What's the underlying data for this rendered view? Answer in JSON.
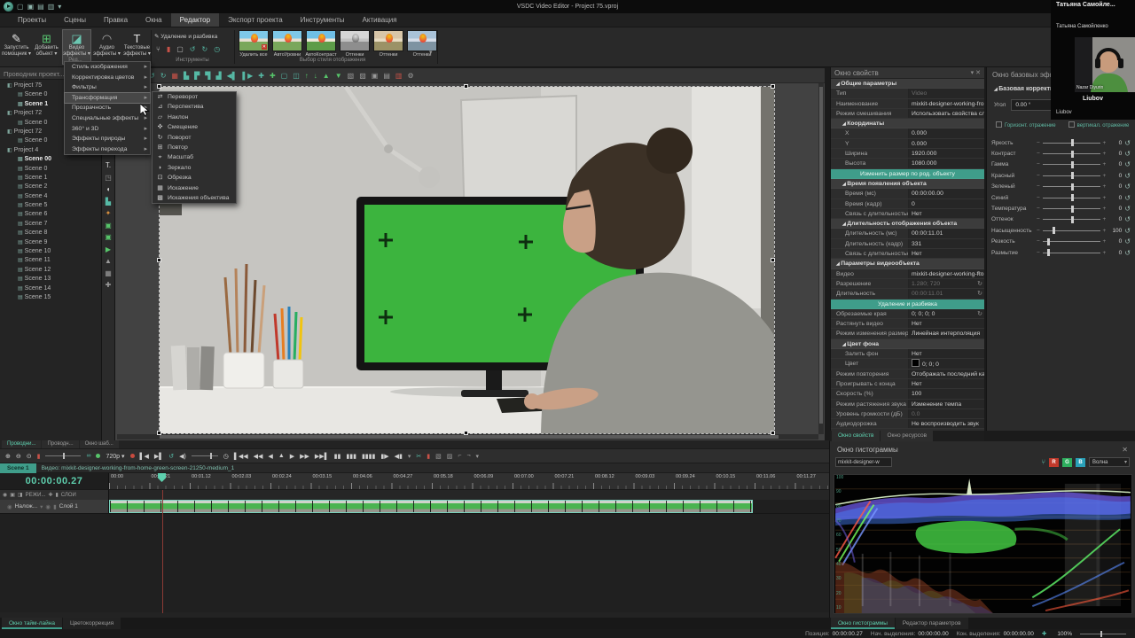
{
  "colors": {
    "accent": "#3f9d8a",
    "accent_text": "#5ecfae",
    "record": "#c84b3f",
    "greenscr": "#3cb43e"
  },
  "titlebar": {
    "title": "VSDC Video Editor - Project 75.vproj"
  },
  "menubar": {
    "items": [
      {
        "label": "Проекты"
      },
      {
        "label": "Сцены"
      },
      {
        "label": "Правка"
      },
      {
        "label": "Окна"
      },
      {
        "label": "Редактор",
        "cls": "active"
      },
      {
        "label": "Экспорт проекта"
      },
      {
        "label": "Инструменты"
      },
      {
        "label": "Активация"
      }
    ]
  },
  "ribbon": {
    "group1_label": "Ред...",
    "big_buttons": [
      {
        "icon": "✎",
        "iconc": "ic-white",
        "line1": "Запустить",
        "line2": "помощник ▾"
      },
      {
        "icon": "⊞",
        "iconc": "ic-green",
        "line1": "Добавить",
        "line2": "объект ▾"
      },
      {
        "icon": "◪",
        "iconc": "ic-teal",
        "line1": "Видео",
        "line2": "эффекты ▾",
        "cls": "pressed"
      },
      {
        "icon": "◠",
        "iconc": "ic-gray",
        "line1": "Аудио",
        "line2": "эффекты ▾"
      },
      {
        "icon": "T",
        "iconc": "ic-white",
        "line1": "Текстовые",
        "line2": "эффекты ▾"
      }
    ],
    "tools": {
      "title": "✎ Удаление и разбивка",
      "label": "Инструменты",
      "icons": [
        {
          "g": "⑂"
        },
        {
          "g": "▮",
          "c": "red"
        },
        {
          "g": "▢"
        },
        {
          "g": "↺",
          "c": "teal"
        },
        {
          "g": "↻",
          "c": "teal"
        },
        {
          "g": "◷",
          "c": "teal"
        }
      ]
    },
    "styles": {
      "label": "Выбор стиля отображения",
      "more": "▾",
      "thumbs": [
        {
          "label": "Удалить все",
          "cls": "t-color t-badge"
        },
        {
          "label": "АвтоУровни",
          "cls": "t-color"
        },
        {
          "label": "АвтоКонтраст",
          "cls": "t-color2"
        },
        {
          "label": "Оттенки",
          "cls": "t-gray"
        },
        {
          "label": "Оттенки",
          "cls": "t-warm"
        },
        {
          "label": "Оттенки",
          "cls": "t-cool"
        }
      ]
    }
  },
  "toolbar2": {
    "icons": [
      {
        "g": "↺"
      },
      {
        "g": "↻"
      },
      {
        "g": "▦",
        "c": "red"
      },
      {
        "g": "▙"
      },
      {
        "g": "▛"
      },
      {
        "g": "▜"
      },
      {
        "g": "▟"
      },
      {
        "g": "◀▌"
      },
      {
        "g": "▌▶"
      },
      {
        "g": "✚"
      },
      {
        "g": "✚",
        "c": "green"
      },
      {
        "g": "▢"
      },
      {
        "g": "◫"
      },
      {
        "g": "↑",
        "c": "green"
      },
      {
        "g": "↓",
        "c": "green"
      },
      {
        "g": "▲",
        "c": "green"
      },
      {
        "g": "▼",
        "c": "green"
      },
      {
        "g": "▧",
        "c": "gray"
      },
      {
        "g": "▨",
        "c": "gray"
      },
      {
        "g": "▣",
        "c": "gray"
      },
      {
        "g": "▤",
        "c": "gray"
      },
      {
        "g": "▥",
        "c": "red"
      },
      {
        "g": "⚙",
        "c": "gray"
      }
    ]
  },
  "explorer": {
    "title": "Проводник проект...",
    "items": [
      {
        "icon": "◧",
        "label": "Project 75",
        "cls": "lvl0"
      },
      {
        "icon": "▤",
        "label": "Scene 0",
        "cls": "lvl1"
      },
      {
        "icon": "▤",
        "label": "Scene 1",
        "cls": "lvl1 bold"
      },
      {
        "icon": "◧",
        "label": "Project 72",
        "cls": "lvl0"
      },
      {
        "icon": "▤",
        "label": "Scene 0",
        "cls": "lvl1"
      },
      {
        "icon": "◧",
        "label": "Project 72",
        "cls": "lvl0"
      },
      {
        "icon": "▤",
        "label": "Scene 0",
        "cls": "lvl1"
      },
      {
        "icon": "◧",
        "label": "Project 4",
        "cls": "lvl0"
      },
      {
        "icon": "▤",
        "label": "Scene 00",
        "cls": "lvl1 bold"
      },
      {
        "icon": "▤",
        "label": "Scene 0",
        "cls": "lvl1"
      },
      {
        "icon": "▤",
        "label": "Scene 1",
        "cls": "lvl1"
      },
      {
        "icon": "▤",
        "label": "Scene 2",
        "cls": "lvl1"
      },
      {
        "icon": "▤",
        "label": "Scene 4",
        "cls": "lvl1"
      },
      {
        "icon": "▤",
        "label": "Scene 5",
        "cls": "lvl1"
      },
      {
        "icon": "▤",
        "label": "Scene 6",
        "cls": "lvl1"
      },
      {
        "icon": "▤",
        "label": "Scene 7",
        "cls": "lvl1"
      },
      {
        "icon": "▤",
        "label": "Scene 8",
        "cls": "lvl1"
      },
      {
        "icon": "▤",
        "label": "Scene 9",
        "cls": "lvl1"
      },
      {
        "icon": "▤",
        "label": "Scene 10",
        "cls": "lvl1"
      },
      {
        "icon": "▤",
        "label": "Scene 11",
        "cls": "lvl1"
      },
      {
        "icon": "▤",
        "label": "Scene 12",
        "cls": "lvl1"
      },
      {
        "icon": "▤",
        "label": "Scene 13",
        "cls": "lvl1"
      },
      {
        "icon": "▤",
        "label": "Scene 14",
        "cls": "lvl1"
      },
      {
        "icon": "▤",
        "label": "Scene 15",
        "cls": "lvl1"
      }
    ]
  },
  "vtoolbar": {
    "icons": [
      {
        "g": "T.",
        "c": "w"
      },
      {
        "g": "◳",
        "c": "gray"
      },
      {
        "g": "◖",
        "c": "w"
      },
      {
        "g": "▙",
        "c": "teal"
      },
      {
        "g": "✦",
        "c": "orange"
      },
      {
        "g": "▣",
        "c": "green"
      },
      {
        "g": "▣",
        "c": "green"
      },
      {
        "g": "▶",
        "c": "green"
      },
      {
        "g": "▲",
        "c": "gray"
      },
      {
        "g": "▦",
        "c": "gray"
      },
      {
        "g": "✚",
        "c": "gray"
      }
    ]
  },
  "effects_menu": {
    "items": [
      {
        "label": "Стиль изображения"
      },
      {
        "label": "Корректировка цветов"
      },
      {
        "label": "Фильтры"
      },
      {
        "label": "Трансформация",
        "cls": "hl"
      },
      {
        "label": "Прозрачность"
      },
      {
        "label": "Специальные эффекты"
      },
      {
        "label": "360° и 3D"
      },
      {
        "label": "Эффекты природы"
      },
      {
        "label": "Эффекты перехода"
      }
    ]
  },
  "transform_submenu": {
    "items": [
      {
        "icon": "⇄",
        "c": "teal",
        "label": "Переворот"
      },
      {
        "icon": "⊿",
        "c": "teal",
        "label": "Перспектива"
      },
      {
        "icon": "▱",
        "c": "teal",
        "label": "Наклон"
      },
      {
        "icon": "✜",
        "c": "red",
        "label": "Смещение"
      },
      {
        "icon": "↻",
        "c": "teal",
        "label": "Поворот"
      },
      {
        "icon": "⊞",
        "c": "green",
        "label": "Повтор"
      },
      {
        "icon": "⌖",
        "c": "teal",
        "label": "Масштаб"
      },
      {
        "icon": "◗",
        "c": "gray",
        "label": "Зеркало"
      },
      {
        "icon": "⊡",
        "c": "teal",
        "label": "Обрезка"
      },
      {
        "icon": "▦",
        "c": "red",
        "label": "Искажение"
      },
      {
        "icon": "▩",
        "c": "red",
        "label": "Искажения объектива"
      }
    ]
  },
  "properties": {
    "title": "Окно свойств",
    "pin": "▾",
    "close": "✕",
    "rows": [
      {
        "cls": "sec",
        "label": "Общие параметры",
        "value": ""
      },
      {
        "cls": "dim",
        "label": "Тип",
        "value": "Video"
      },
      {
        "label": "Наименование",
        "value": "mixkit-designer-working-from-l"
      },
      {
        "label": "Режим смешивания",
        "value": "Использовать свойства слоя"
      },
      {
        "cls": "sec sub",
        "label": "Координаты",
        "value": ""
      },
      {
        "cls": "ind",
        "label": "X",
        "value": "0.000"
      },
      {
        "cls": "ind",
        "label": "Y",
        "value": "0.000"
      },
      {
        "cls": "ind",
        "label": "Ширина",
        "value": "1920.000"
      },
      {
        "cls": "ind",
        "label": "Высота",
        "value": "1080.000"
      },
      {
        "cls": "btn",
        "label": "Изменить размер по род. объекту",
        "value": ""
      },
      {
        "cls": "sec sub",
        "label": "Время появления объекта",
        "value": ""
      },
      {
        "cls": "ind",
        "label": "Время (мс)",
        "value": "00:00:00.00"
      },
      {
        "cls": "ind",
        "label": "Время (кадр)",
        "value": "0"
      },
      {
        "cls": "ind",
        "label": "Связь с длительностью р...",
        "value": "Нет"
      },
      {
        "cls": "sec sub",
        "label": "Длительность отображения объекта",
        "value": ""
      },
      {
        "cls": "ind",
        "label": "Длительность (мс)",
        "value": "00:00:11.01"
      },
      {
        "cls": "ind",
        "label": "Длительность (кадр)",
        "value": "331"
      },
      {
        "cls": "ind",
        "label": "Связь с длительностью р...",
        "value": "Нет"
      },
      {
        "cls": "sec",
        "label": "Параметры видеообъекта",
        "value": ""
      },
      {
        "cls": "ricon",
        "label": "Видео",
        "value": "mixkit-designer-working-fro"
      },
      {
        "cls": "dim ricon",
        "label": "Разрешение",
        "value": "1.280; 720"
      },
      {
        "cls": "dim ricon",
        "label": "Длительность",
        "value": "00:00:11.01"
      },
      {
        "cls": "btn",
        "label": "Удаление и разбивка",
        "value": ""
      },
      {
        "cls": "ricon",
        "label": "Обрезаемые края",
        "value": "0; 0; 0; 0"
      },
      {
        "label": "Растянуть видео",
        "value": "Нет"
      },
      {
        "label": "Режим изменения размера",
        "value": "Линейная интерполяция"
      },
      {
        "cls": "sec sub",
        "label": "Цвет фона",
        "value": ""
      },
      {
        "cls": "ind",
        "label": "Залить фон",
        "value": "Нет"
      },
      {
        "cls": "ind swatch",
        "label": "Цвет",
        "value": "0; 0; 0"
      },
      {
        "label": "Режим повторения",
        "value": "Отображать последний кадр п"
      },
      {
        "label": "Проигрывать с конца",
        "value": "Нет"
      },
      {
        "label": "Скорость (%)",
        "value": "100"
      },
      {
        "label": "Режим растяжения звука",
        "value": "Изменение темпа"
      },
      {
        "cls": "dim",
        "label": "Уровень громкости (дБ)",
        "value": "0.0"
      },
      {
        "label": "Аудиодорожка",
        "value": "Не воспроизводить звук"
      }
    ],
    "tabs": [
      {
        "label": "Окно свойств",
        "cls": "active"
      },
      {
        "label": "Окно ресурсов"
      }
    ]
  },
  "basic_effects": {
    "title": "Окно базовых эффектов",
    "section": "Базовая корректировка",
    "angle_label": "Угол",
    "angle_value": "0.00 °",
    "flip_h": "Горизонт. отражение",
    "flip_v": "вертикал. отражение",
    "reset_icon": "↺",
    "sliders": [
      {
        "label": "Яркость",
        "value": "0",
        "style": "--pos:50%"
      },
      {
        "label": "Контраст",
        "value": "0",
        "style": "--pos:50%"
      },
      {
        "label": "Гамма",
        "value": "0",
        "style": "--pos:50%"
      },
      {
        "label": "Красный",
        "value": "0",
        "style": "--pos:50%"
      },
      {
        "label": "Зеленый",
        "value": "0",
        "style": "--pos:50%"
      },
      {
        "label": "Синий",
        "value": "0",
        "style": "--pos:50%"
      },
      {
        "label": "Температура",
        "value": "0",
        "style": "--pos:50%"
      },
      {
        "label": "Оттенок",
        "value": "0",
        "style": "--pos:50%"
      },
      {
        "label": "Насыщенность",
        "value": "100",
        "style": "--pos:18%"
      },
      {
        "label": "Резкость",
        "value": "0",
        "style": "--pos:8%"
      },
      {
        "label": "Размытие",
        "value": "0",
        "style": "--pos:8%"
      }
    ]
  },
  "overlay": {
    "title": "Татьяна Самойле...",
    "name1": "Татьяна Самойленко",
    "cam_name": "Nazar Diyurin",
    "name2": "Liubov",
    "name3": "Liubov"
  },
  "timeline": {
    "tabs": [
      {
        "label": "Проводни...",
        "cls": "active"
      },
      {
        "label": "Проводн..."
      },
      {
        "label": "Окно шаб..."
      }
    ],
    "zoom_icons": [
      {
        "g": "⊕"
      },
      {
        "g": "⊖"
      },
      {
        "g": "⊙"
      },
      {
        "g": "▮",
        "c": "red"
      }
    ],
    "res_label": "720p ▾",
    "marker_icons": [
      {
        "g": "▌◀"
      },
      {
        "g": "▶▌"
      },
      {
        "g": "↺",
        "c": "teal"
      },
      {
        "g": "◀)"
      }
    ],
    "transport": [
      {
        "g": "◷"
      },
      {
        "g": "▌◀◀"
      },
      {
        "g": "◀◀"
      },
      {
        "g": "◀"
      },
      {
        "g": "▲"
      },
      {
        "g": "▶"
      },
      {
        "g": "▶▶"
      },
      {
        "g": "▶▶▌"
      },
      {
        "g": "▮▮"
      },
      {
        "g": "▮▮▮"
      },
      {
        "g": "▮▮▮▮"
      },
      {
        "g": "▮▶"
      },
      {
        "g": "◀▮"
      },
      {
        "g": "▾",
        "c": "gray"
      }
    ],
    "cut_icons": [
      {
        "g": "✂",
        "c": "teal"
      },
      {
        "g": "▮",
        "c": "red"
      },
      {
        "g": "▧",
        "c": "gray"
      },
      {
        "g": "▨",
        "c": "gray"
      },
      {
        "g": "⌐",
        "c": "gray"
      },
      {
        "g": "¬",
        "c": "gray"
      },
      {
        "g": "▾",
        "c": "gray"
      }
    ],
    "scene_tab": "Scene 1",
    "clip_label": "Видео: mixkit-designer-working-from-home-green-screen-21250-medium_1",
    "timecode": "00:00:00.27",
    "ruler": [
      "00:00",
      "00:00.21",
      "00:01.12",
      "00:02.03",
      "00:02.24",
      "00:03.15",
      "00:04.06",
      "00:04.27",
      "00:05.18",
      "00:06.09",
      "00:07.00",
      "00:07.21",
      "00:08.12",
      "00:09.03",
      "00:09.24",
      "00:10.15",
      "00:11.06",
      "00:11.27"
    ],
    "header_modes": "РЕЖИ...",
    "header_layers": "СЛОИ",
    "track_mode": "Налож...",
    "track_name": "Слой 1"
  },
  "histogram": {
    "title": "Окно гистограммы",
    "close": "✕",
    "source": "mixkit-designer-w",
    "channels": [
      {
        "label": "R",
        "cls": "r"
      },
      {
        "label": "G",
        "cls": "g"
      },
      {
        "label": "B",
        "cls": "b"
      }
    ],
    "mode": "Волна",
    "scale": [
      "100",
      "90",
      "80",
      "70",
      "60",
      "50",
      "40",
      "30",
      "20",
      "10"
    ]
  },
  "bottom": {
    "left_tabs": [
      {
        "label": "Окно тайм-лайна",
        "cls": "active"
      },
      {
        "label": "Цветокоррекция"
      }
    ],
    "right_tabs": [
      {
        "label": "Окно гистограммы",
        "cls": "active"
      },
      {
        "label": "Редактор параметров"
      }
    ],
    "status": [
      {
        "label": "Позиция:",
        "value": "00:00:00.27"
      },
      {
        "label": "Нач. выделения:",
        "value": "00:00:00.00"
      },
      {
        "label": "Кон. выделения:",
        "value": "00:00:00.00"
      }
    ],
    "zoom_icon": "✚",
    "zoom_value": "100%"
  }
}
